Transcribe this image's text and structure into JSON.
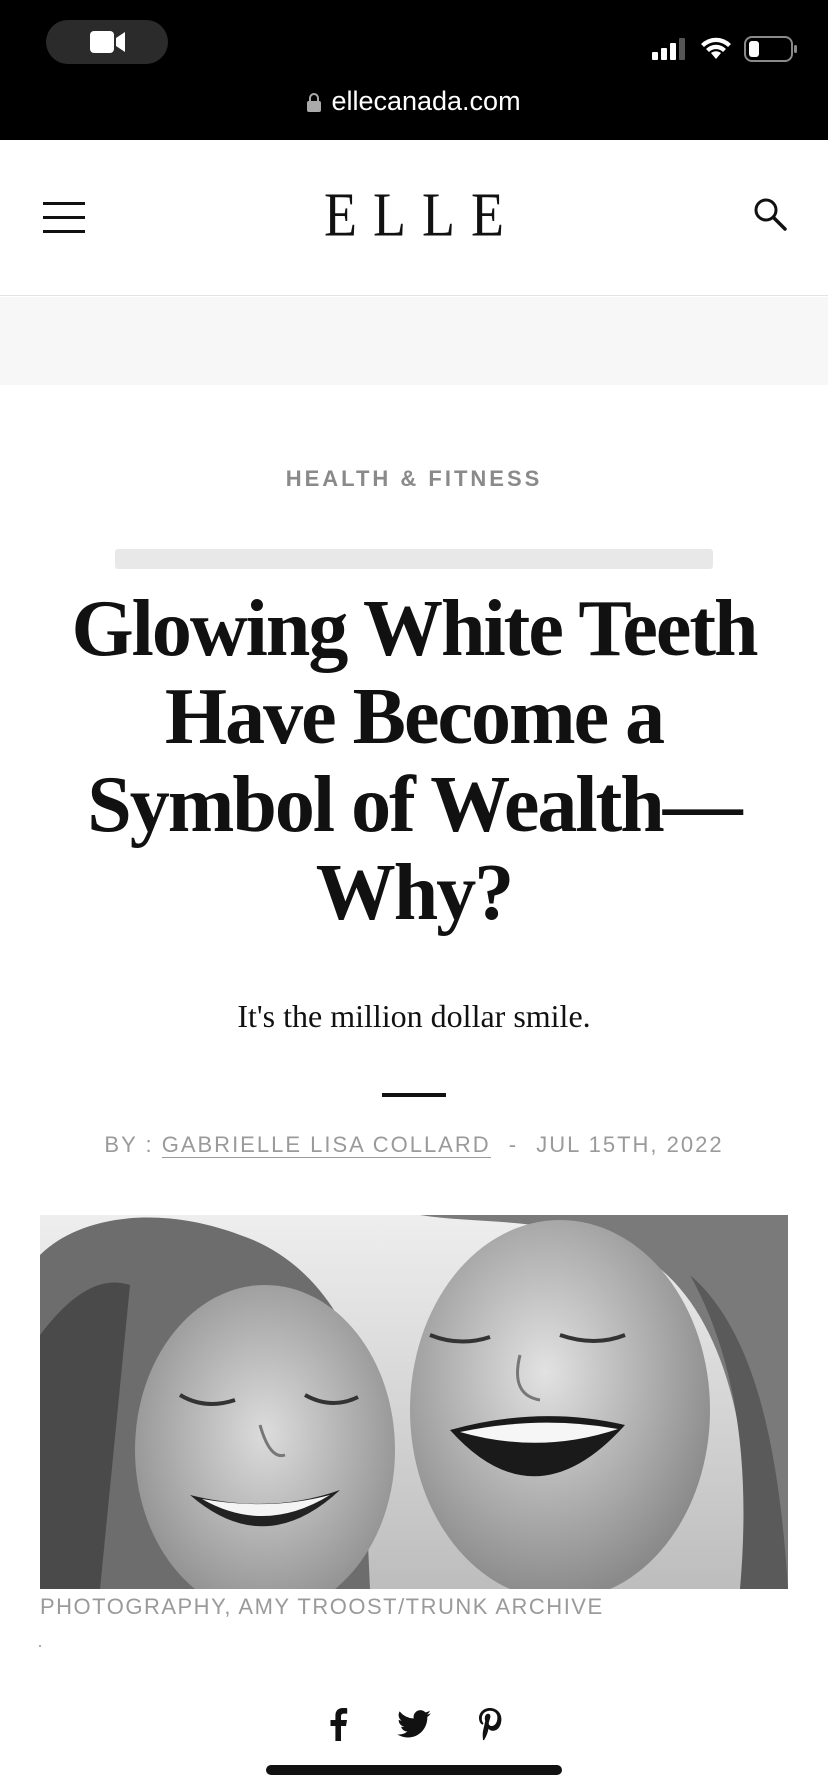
{
  "browser": {
    "url": "ellecanada.com"
  },
  "header": {
    "logo": "ELLE"
  },
  "article": {
    "category": "HEALTH & FITNESS",
    "headline_lines": [
      "Glowing White Teeth",
      "Have Become a",
      "Symbol of Wealth—",
      "Why?"
    ],
    "dek": "It's the million dollar smile.",
    "byline_prefix": "BY :",
    "author": "GABRIELLE LISA COLLARD",
    "byline_sep": "-",
    "date": "JUL 15TH, 2022",
    "photo_caption": "PHOTOGRAPHY, AMY TROOST/TRUNK ARCHIVE"
  },
  "icons": {
    "menu": "hamburger-menu-icon",
    "search": "search-icon",
    "facebook": "facebook-icon",
    "twitter": "twitter-icon",
    "pinterest": "pinterest-icon"
  }
}
